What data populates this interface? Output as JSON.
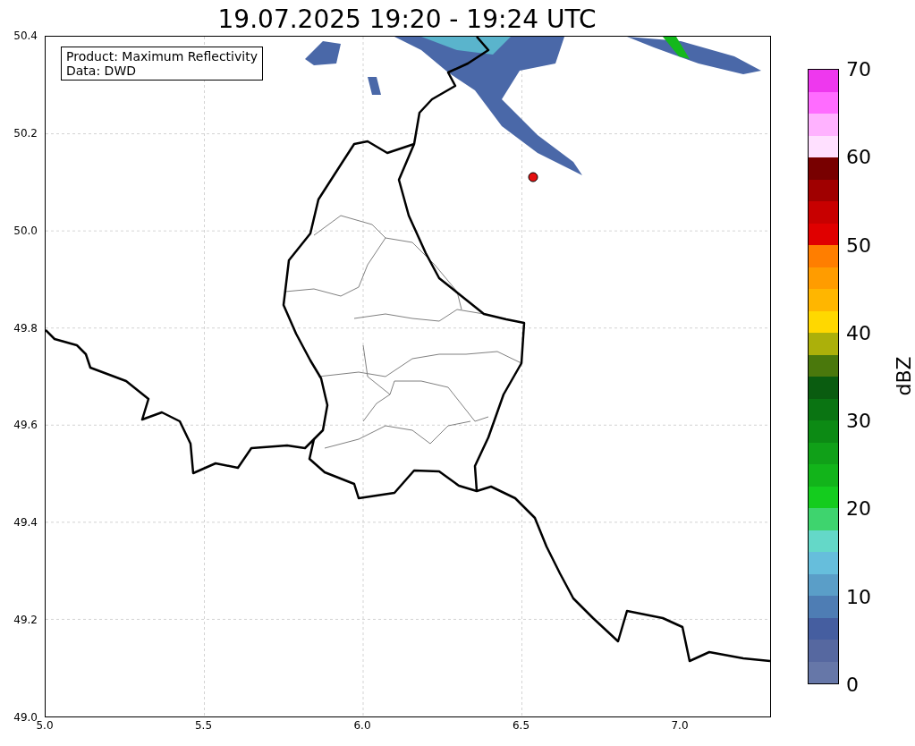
{
  "title": "19.07.2025 19:20 - 19:24 UTC",
  "info_box": {
    "lines": [
      "Product: Maximum Reflectivity",
      "Data: DWD"
    ]
  },
  "map": {
    "x_ticks": [
      "5.0",
      "5.5",
      "6.0",
      "6.5",
      "7.0"
    ],
    "y_ticks": [
      "50.4",
      "50.2",
      "50.0",
      "49.8",
      "49.6",
      "49.4",
      "49.2",
      "49.0"
    ]
  },
  "colorbar": {
    "label": "dBZ",
    "ticks": [
      "70",
      "60",
      "50",
      "40",
      "30",
      "20",
      "10",
      "0"
    ],
    "segments": [
      {
        "color": "#6677a8"
      },
      {
        "color": "#5668a0"
      },
      {
        "color": "#455ea0"
      },
      {
        "color": "#4e7db4"
      },
      {
        "color": "#5a9ec8"
      },
      {
        "color": "#66bedc"
      },
      {
        "color": "#64d8c8"
      },
      {
        "color": "#3ed46e"
      },
      {
        "color": "#14cc1e"
      },
      {
        "color": "#12b41a"
      },
      {
        "color": "#10a018"
      },
      {
        "color": "#0c8a14"
      },
      {
        "color": "#0a7412"
      },
      {
        "color": "#0a5c10"
      },
      {
        "color": "#4a780c"
      },
      {
        "color": "#acb00a"
      },
      {
        "color": "#ffd800"
      },
      {
        "color": "#ffb600"
      },
      {
        "color": "#ff9c00"
      },
      {
        "color": "#ff7e00"
      },
      {
        "color": "#e00000"
      },
      {
        "color": "#c80000"
      },
      {
        "color": "#a00000"
      },
      {
        "color": "#780000"
      },
      {
        "color": "#ffe0ff"
      },
      {
        "color": "#ffb2ff"
      },
      {
        "color": "#ff6cff"
      },
      {
        "color": "#ee38ee"
      }
    ]
  }
}
